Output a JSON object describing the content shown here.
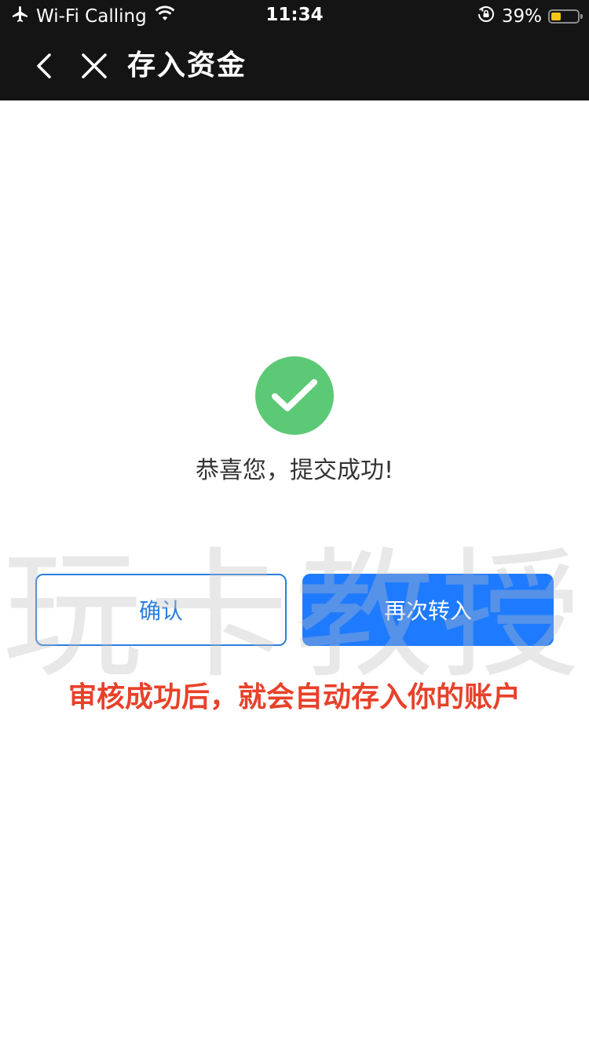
{
  "status_bar": {
    "carrier": "Wi-Fi Calling",
    "time": "11:34",
    "battery_percent": "39%",
    "battery_level": 0.39,
    "icons": [
      "airplane-icon",
      "wifi-icon",
      "rotation-lock-icon",
      "battery-icon"
    ]
  },
  "nav": {
    "title": "存入资金",
    "back_icon": "back-icon",
    "close_icon": "close-icon"
  },
  "result": {
    "icon": "check-circle-icon",
    "icon_color": "#5cc976",
    "message": "恭喜您，提交成功!"
  },
  "buttons": {
    "confirm_label": "确认",
    "again_label": "再次转入",
    "primary_color": "#1e7bff"
  },
  "overlay": {
    "watermark": "玩卡教授",
    "notice": "审核成功后，就会自动存入你的账户",
    "notice_color": "#e8412a"
  }
}
